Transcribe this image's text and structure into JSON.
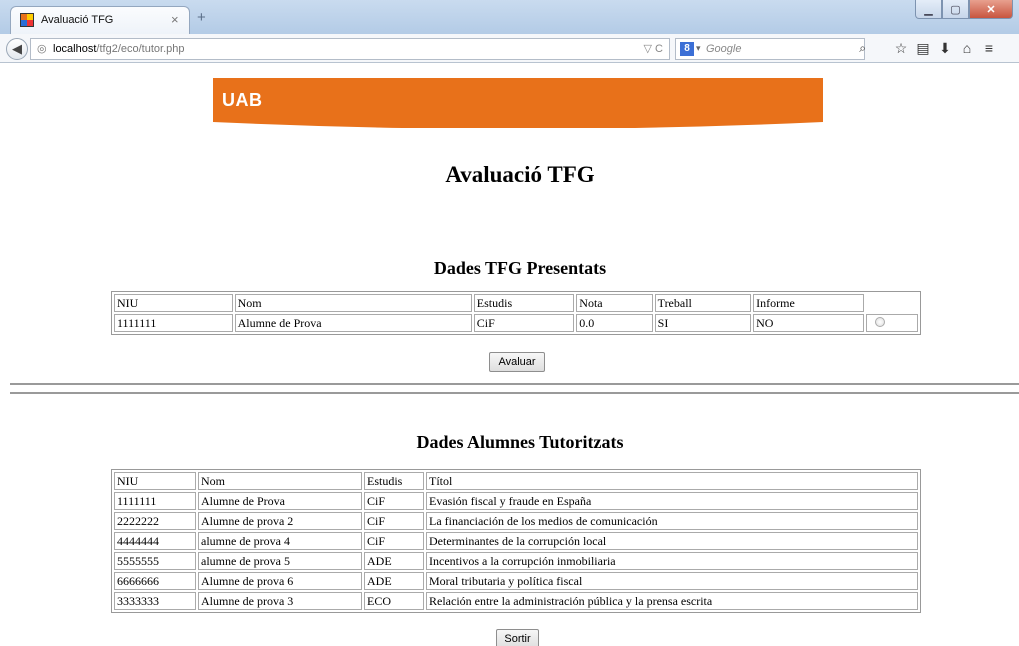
{
  "browser": {
    "tab_title": "Avaluació TFG",
    "tab_close": "×",
    "new_tab": "+",
    "url_host": "localhost",
    "url_path": "/tfg2/eco/tutor.php",
    "search_engine_badge": "8",
    "search_placeholder": "Google",
    "icons": [
      "back-arrow-icon",
      "globe-icon",
      "reload-icon",
      "search-icon",
      "bookmark-star-icon",
      "reading-list-icon",
      "download-icon",
      "home-icon",
      "menu-icon"
    ]
  },
  "banner": {
    "logo_text": "UAB",
    "color": "#e8711a"
  },
  "page": {
    "title": "Avaluació TFG"
  },
  "presented": {
    "title": "Dades TFG Presentats",
    "headers": [
      "NIU",
      "Nom",
      "Estudis",
      "Nota",
      "Treball",
      "Informe"
    ],
    "rows": [
      [
        "1111111",
        "Alumne de Prova",
        "CiF",
        "0.0",
        "SI",
        "NO"
      ]
    ],
    "button": "Avaluar"
  },
  "tutored": {
    "title": "Dades Alumnes Tutoritzats",
    "headers": [
      "NIU",
      "Nom",
      "Estudis",
      "Títol"
    ],
    "rows": [
      [
        "1111111",
        "Alumne de Prova",
        "CiF",
        "Evasión fiscal y fraude en España"
      ],
      [
        "2222222",
        "Alumne de prova 2",
        "CiF",
        "La financiación de los medios de comunicación"
      ],
      [
        "4444444",
        "alumne de prova 4",
        "CiF",
        "Determinantes de la corrupción local"
      ],
      [
        "5555555",
        "alumne de prova 5",
        "ADE",
        "Incentivos a la corrupción inmobiliaria"
      ],
      [
        "6666666",
        "Alumne de prova 6",
        "ADE",
        "Moral tributaria y política fiscal"
      ],
      [
        "3333333",
        "Alumne de prova 3",
        "ECO",
        "Relación entre la administración pública y la prensa escrita"
      ]
    ],
    "button": "Sortir"
  }
}
